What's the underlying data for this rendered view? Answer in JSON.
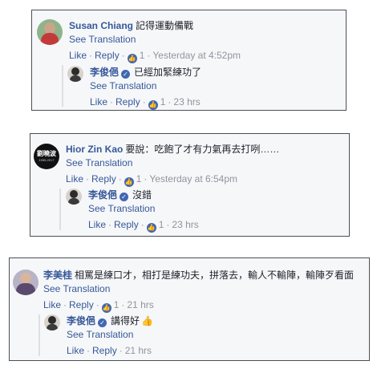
{
  "common": {
    "see_translation": "See Translation",
    "like": "Like",
    "reply": "Reply",
    "dot": "·",
    "check": "✓",
    "like_glyph": "👍"
  },
  "colors": {
    "link": "#365899",
    "meta": "#90949c",
    "like_blue": "#4267b2"
  },
  "threads": [
    {
      "comment": {
        "author": "Susan Chiang",
        "text": "記得運動備戰",
        "likes": "1",
        "time": "Yesterday at 4:52pm"
      },
      "reply": {
        "author": "李俊俋",
        "text": "已經加緊練功了",
        "likes": "1",
        "time": "23 hrs"
      }
    },
    {
      "comment": {
        "author": "Hior Zin Kao",
        "text": "要說：吃飽了才有力氣再去打咧……",
        "likes": "1",
        "time": "Yesterday at 6:54pm",
        "avatar_text": "劉曉波",
        "avatar_sub": "1955-2017"
      },
      "reply": {
        "author": "李俊俋",
        "text": "沒錯",
        "likes": "1",
        "time": "23 hrs"
      }
    },
    {
      "comment": {
        "author": "李美桂",
        "text": "相罵是練口才，相打是練功夫，拼落去，輸人不輸陣，輸陣歹看面",
        "likes": "1",
        "time": "21 hrs"
      },
      "reply": {
        "author": "李俊俋",
        "text": "講得好",
        "emoji": "👍",
        "time": "21 hrs"
      }
    }
  ]
}
